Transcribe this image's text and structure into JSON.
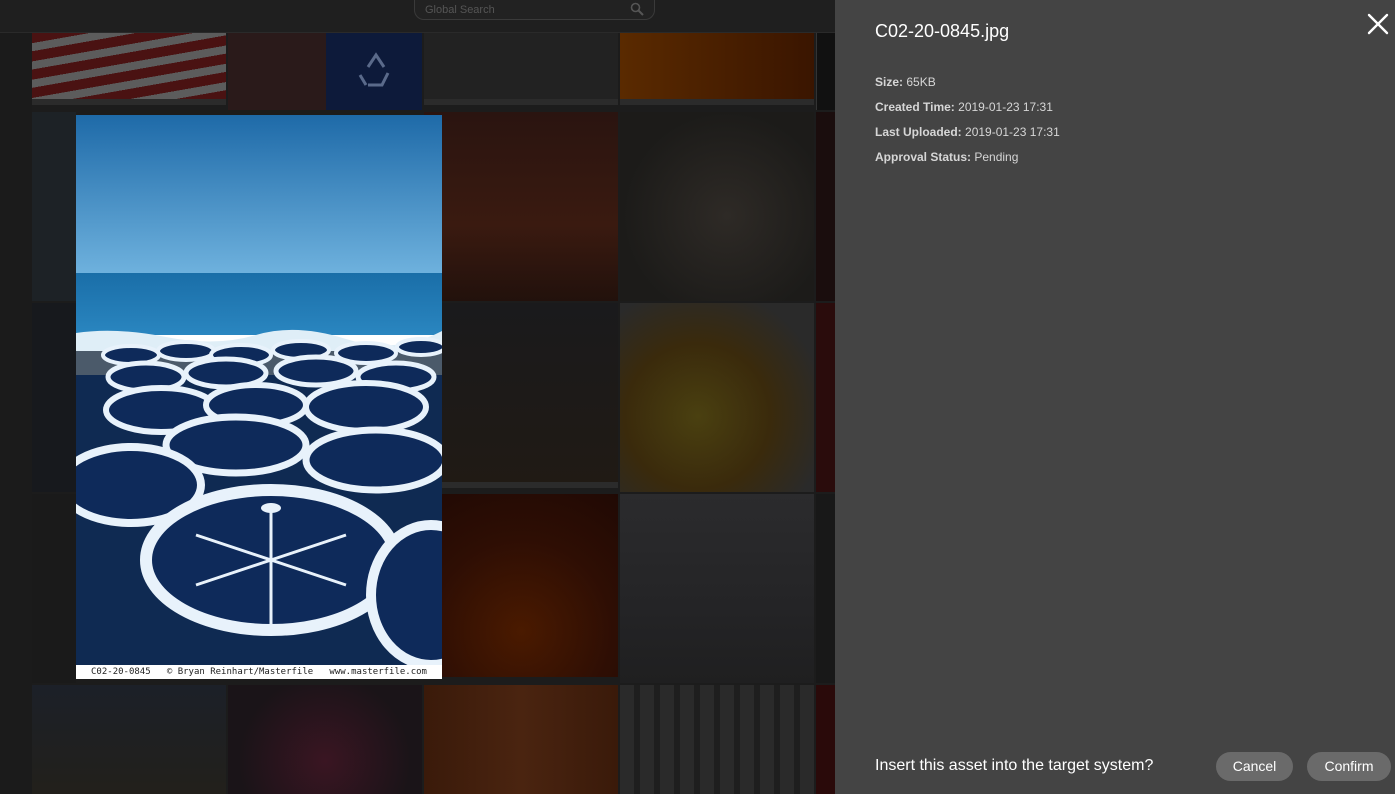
{
  "search": {
    "placeholder": "Global Search"
  },
  "preview": {
    "caption": "C02-20-0845   © Bryan Reinhart/Masterfile   www.masterfile.com"
  },
  "panel": {
    "title": "C02-20-0845.jpg",
    "meta": [
      {
        "label": "Size:",
        "value": "65KB"
      },
      {
        "label": "Created Time:",
        "value": "2019-01-23 17:31"
      },
      {
        "label": "Last Uploaded:",
        "value": "2019-01-23 17:31"
      },
      {
        "label": "Approval Status:",
        "value": "Pending"
      }
    ],
    "question": "Insert this asset into the target system?",
    "cancel_label": "Cancel",
    "confirm_label": "Confirm"
  },
  "icons": {
    "search": "search-icon",
    "close": "close-icon"
  },
  "colors": {
    "panel_bg": "#444444",
    "button_bg": "#6a6a6a",
    "overlay_bg": "#1c1c1c"
  }
}
